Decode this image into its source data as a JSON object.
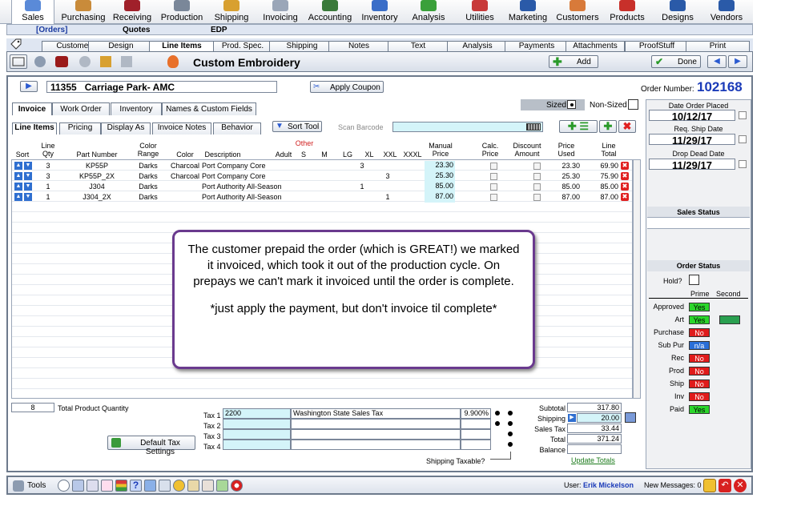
{
  "nav": {
    "items": [
      {
        "label": "Sales",
        "icon": "sales-icon"
      },
      {
        "label": "Purchasing",
        "icon": "purchasing-icon"
      },
      {
        "label": "Receiving",
        "icon": "receiving-icon"
      },
      {
        "label": "Production",
        "icon": "production-icon"
      },
      {
        "label": "Shipping",
        "icon": "shipping-icon"
      },
      {
        "label": "Invoicing",
        "icon": "invoicing-icon"
      },
      {
        "label": "Accounting",
        "icon": "accounting-icon"
      },
      {
        "label": "Inventory",
        "icon": "inventory-icon"
      },
      {
        "label": "Analysis",
        "icon": "analysis-icon"
      },
      {
        "label": "Utilities",
        "icon": "utilities-icon"
      },
      {
        "label": "Marketing",
        "icon": "marketing-icon"
      },
      {
        "label": "Customers",
        "icon": "customers-icon"
      },
      {
        "label": "Products",
        "icon": "products-icon"
      },
      {
        "label": "Designs",
        "icon": "designs-icon"
      },
      {
        "label": "Vendors",
        "icon": "vendors-icon"
      }
    ]
  },
  "subnav": {
    "orders": "[Orders]",
    "quotes": "Quotes",
    "edp": "EDP"
  },
  "tabs": [
    "Customer",
    "Design",
    "Line Items",
    "Prod. Spec.",
    "Shipping",
    "Notes",
    "Text",
    "Analysis",
    "Payments",
    "Attachments",
    "ProofStuff",
    "Print"
  ],
  "toolbar": {
    "title": "Custom Embroidery",
    "add": "Add",
    "done": "Done"
  },
  "order": {
    "customer_id": "11355",
    "customer_name": "Carriage Park- AMC",
    "apply_coupon": "Apply Coupon",
    "number_label": "Order Number:",
    "number": "102168"
  },
  "subtabs": [
    "Invoice",
    "Work Order",
    "Inventory",
    "Names & Custom Fields"
  ],
  "sized": {
    "sized": "Sized",
    "nonsized": "Non-Sized"
  },
  "linetabs": [
    "Line Items",
    "Pricing",
    "Display As",
    "Invoice Notes",
    "Behavior"
  ],
  "sort_tool": "Sort Tool",
  "scan_barcode": "Scan Barcode",
  "columns": {
    "sort": "Sort",
    "qty": "Line\nQty",
    "part": "Part Number",
    "range": "Color\nRange",
    "color": "Color",
    "desc": "Description",
    "other": "Other",
    "adult": "Adult",
    "s": "S",
    "m": "M",
    "lg": "LG",
    "xl": "XL",
    "xxl": "XXL",
    "xxxl": "XXXL",
    "manual": "Manual\nPrice",
    "calc": "Calc.\nPrice",
    "disc": "Discount\nAmount",
    "used": "Price\nUsed",
    "total": "Line\nTotal"
  },
  "rows": [
    {
      "qty": "3",
      "part": "KP55P",
      "range": "Darks",
      "color": "Charcoal",
      "desc": "Port  Company Core",
      "xl": "3",
      "xxl": "",
      "manual": "23.30",
      "used": "23.30",
      "total": "69.90"
    },
    {
      "qty": "3",
      "part": "KP55P_2X",
      "range": "Darks",
      "color": "Charcoal",
      "desc": "Port  Company Core",
      "xl": "",
      "xxl": "3",
      "manual": "25.30",
      "used": "25.30",
      "total": "75.90"
    },
    {
      "qty": "1",
      "part": "J304",
      "range": "Darks",
      "color": "",
      "desc": "Port Authority All-Season",
      "xl": "1",
      "xxl": "",
      "manual": "85.00",
      "used": "85.00",
      "total": "85.00"
    },
    {
      "qty": "1",
      "part": "J304_2X",
      "range": "Darks",
      "color": "",
      "desc": "Port Authority All-Season",
      "xl": "",
      "xxl": "1",
      "manual": "87.00",
      "used": "87.00",
      "total": "87.00"
    }
  ],
  "callout": {
    "line1": "The customer prepaid the order (which is  GREAT!) we marked it invoiced, which took it out of the production cycle. On prepays we can't mark it invoiced until the order is complete.",
    "line2": "*just apply the payment, but don't invoice til complete*"
  },
  "totals": {
    "qty": "8",
    "qty_label": "Total Product Quantity",
    "tax1_label": "Tax 1",
    "tax1_code": "2200",
    "tax1_name": "Washington State Sales Tax",
    "tax1_rate": "9.900%",
    "tax2_label": "Tax 2",
    "tax3_label": "Tax 3",
    "tax4_label": "Tax 4",
    "default_tax": "Default Tax Settings",
    "ship_taxable": "Shipping Taxable?",
    "subtotal_label": "Subtotal",
    "subtotal": "317.80",
    "shipping_label": "Shipping",
    "shipping": "20.00",
    "salestax_label": "Sales Tax",
    "salestax": "33.44",
    "total_label": "Total",
    "total": "371.24",
    "balance_label": "Balance",
    "balance": "",
    "update": "Update Totals"
  },
  "dates": {
    "placed_label": "Date Order Placed",
    "placed": "10/12/17",
    "ship_label": "Req. Ship Date",
    "ship": "11/29/17",
    "dead_label": "Drop Dead Date",
    "dead": "11/29/17"
  },
  "sales_status": "Sales Status",
  "order_status": {
    "title": "Order Status",
    "hold": "Hold?",
    "prime": "Prime",
    "second": "Second",
    "items": [
      {
        "label": "Approved",
        "val": "Yes",
        "color": "#2bd62b"
      },
      {
        "label": "Art",
        "val": "Yes",
        "color": "#2bd62b"
      },
      {
        "label": "Purchase",
        "val": "No",
        "color": "#e01b1b"
      },
      {
        "label": "Sub Pur",
        "val": "n/a",
        "color": "#2a6fd8"
      },
      {
        "label": "Rec",
        "val": "No",
        "color": "#e01b1b"
      },
      {
        "label": "Prod",
        "val": "No",
        "color": "#e01b1b"
      },
      {
        "label": "Ship",
        "val": "No",
        "color": "#e01b1b"
      },
      {
        "label": "Inv",
        "val": "No",
        "color": "#e01b1b"
      },
      {
        "label": "Paid",
        "val": "Yes",
        "color": "#2bd62b"
      }
    ]
  },
  "bottom": {
    "tools": "Tools",
    "user_label": "User:",
    "user": "Erik Mickelson",
    "messages": "New Messages: 0"
  }
}
